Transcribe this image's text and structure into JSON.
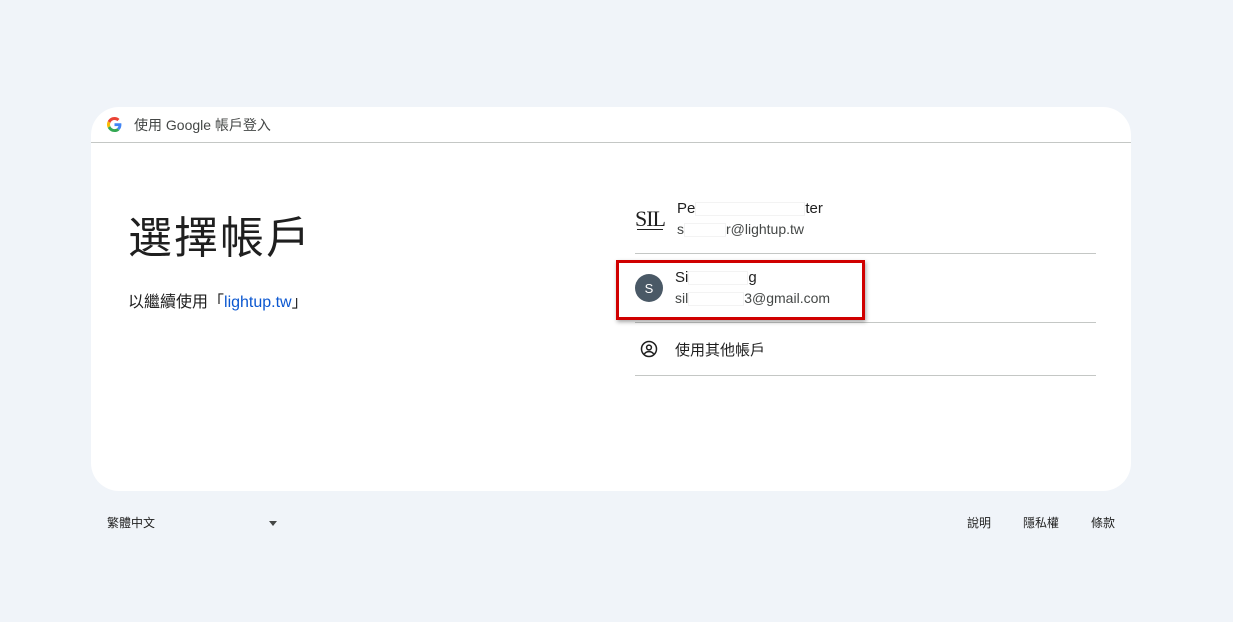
{
  "header": {
    "logo_icon": "google-g-icon",
    "text": "使用 Google 帳戶登入"
  },
  "main": {
    "title": "選擇帳戶",
    "subtitle_prefix": "以繼續使用「",
    "subtitle_link": "lightup.tw",
    "subtitle_suffix": "」"
  },
  "accounts": [
    {
      "avatar_text": "SIL",
      "name_start": "Pe",
      "name_end": "ter",
      "email_start": "s",
      "email_end": "r@lightup.tw"
    },
    {
      "avatar_text": "S",
      "name_start": "Si",
      "name_end": "g",
      "email_start": "sil",
      "email_end": "3@gmail.com",
      "highlighted": true
    }
  ],
  "other_account": {
    "icon": "account-circle-icon",
    "label": "使用其他帳戶"
  },
  "footer": {
    "language": "繁體中文",
    "links": [
      "說明",
      "隱私權",
      "條款"
    ]
  },
  "colors": {
    "background": "#f0f4f9",
    "link": "#0b57d0",
    "avatar": "#4a5966",
    "highlight_border": "#d00000"
  }
}
